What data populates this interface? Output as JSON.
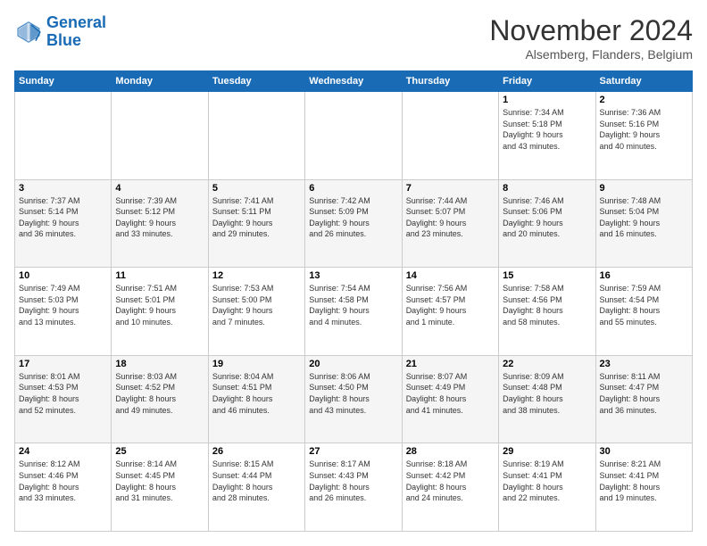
{
  "logo": {
    "line1": "General",
    "line2": "Blue"
  },
  "title": "November 2024",
  "location": "Alsemberg, Flanders, Belgium",
  "days_header": [
    "Sunday",
    "Monday",
    "Tuesday",
    "Wednesday",
    "Thursday",
    "Friday",
    "Saturday"
  ],
  "weeks": [
    [
      {
        "day": "",
        "info": ""
      },
      {
        "day": "",
        "info": ""
      },
      {
        "day": "",
        "info": ""
      },
      {
        "day": "",
        "info": ""
      },
      {
        "day": "",
        "info": ""
      },
      {
        "day": "1",
        "info": "Sunrise: 7:34 AM\nSunset: 5:18 PM\nDaylight: 9 hours\nand 43 minutes."
      },
      {
        "day": "2",
        "info": "Sunrise: 7:36 AM\nSunset: 5:16 PM\nDaylight: 9 hours\nand 40 minutes."
      }
    ],
    [
      {
        "day": "3",
        "info": "Sunrise: 7:37 AM\nSunset: 5:14 PM\nDaylight: 9 hours\nand 36 minutes."
      },
      {
        "day": "4",
        "info": "Sunrise: 7:39 AM\nSunset: 5:12 PM\nDaylight: 9 hours\nand 33 minutes."
      },
      {
        "day": "5",
        "info": "Sunrise: 7:41 AM\nSunset: 5:11 PM\nDaylight: 9 hours\nand 29 minutes."
      },
      {
        "day": "6",
        "info": "Sunrise: 7:42 AM\nSunset: 5:09 PM\nDaylight: 9 hours\nand 26 minutes."
      },
      {
        "day": "7",
        "info": "Sunrise: 7:44 AM\nSunset: 5:07 PM\nDaylight: 9 hours\nand 23 minutes."
      },
      {
        "day": "8",
        "info": "Sunrise: 7:46 AM\nSunset: 5:06 PM\nDaylight: 9 hours\nand 20 minutes."
      },
      {
        "day": "9",
        "info": "Sunrise: 7:48 AM\nSunset: 5:04 PM\nDaylight: 9 hours\nand 16 minutes."
      }
    ],
    [
      {
        "day": "10",
        "info": "Sunrise: 7:49 AM\nSunset: 5:03 PM\nDaylight: 9 hours\nand 13 minutes."
      },
      {
        "day": "11",
        "info": "Sunrise: 7:51 AM\nSunset: 5:01 PM\nDaylight: 9 hours\nand 10 minutes."
      },
      {
        "day": "12",
        "info": "Sunrise: 7:53 AM\nSunset: 5:00 PM\nDaylight: 9 hours\nand 7 minutes."
      },
      {
        "day": "13",
        "info": "Sunrise: 7:54 AM\nSunset: 4:58 PM\nDaylight: 9 hours\nand 4 minutes."
      },
      {
        "day": "14",
        "info": "Sunrise: 7:56 AM\nSunset: 4:57 PM\nDaylight: 9 hours\nand 1 minute."
      },
      {
        "day": "15",
        "info": "Sunrise: 7:58 AM\nSunset: 4:56 PM\nDaylight: 8 hours\nand 58 minutes."
      },
      {
        "day": "16",
        "info": "Sunrise: 7:59 AM\nSunset: 4:54 PM\nDaylight: 8 hours\nand 55 minutes."
      }
    ],
    [
      {
        "day": "17",
        "info": "Sunrise: 8:01 AM\nSunset: 4:53 PM\nDaylight: 8 hours\nand 52 minutes."
      },
      {
        "day": "18",
        "info": "Sunrise: 8:03 AM\nSunset: 4:52 PM\nDaylight: 8 hours\nand 49 minutes."
      },
      {
        "day": "19",
        "info": "Sunrise: 8:04 AM\nSunset: 4:51 PM\nDaylight: 8 hours\nand 46 minutes."
      },
      {
        "day": "20",
        "info": "Sunrise: 8:06 AM\nSunset: 4:50 PM\nDaylight: 8 hours\nand 43 minutes."
      },
      {
        "day": "21",
        "info": "Sunrise: 8:07 AM\nSunset: 4:49 PM\nDaylight: 8 hours\nand 41 minutes."
      },
      {
        "day": "22",
        "info": "Sunrise: 8:09 AM\nSunset: 4:48 PM\nDaylight: 8 hours\nand 38 minutes."
      },
      {
        "day": "23",
        "info": "Sunrise: 8:11 AM\nSunset: 4:47 PM\nDaylight: 8 hours\nand 36 minutes."
      }
    ],
    [
      {
        "day": "24",
        "info": "Sunrise: 8:12 AM\nSunset: 4:46 PM\nDaylight: 8 hours\nand 33 minutes."
      },
      {
        "day": "25",
        "info": "Sunrise: 8:14 AM\nSunset: 4:45 PM\nDaylight: 8 hours\nand 31 minutes."
      },
      {
        "day": "26",
        "info": "Sunrise: 8:15 AM\nSunset: 4:44 PM\nDaylight: 8 hours\nand 28 minutes."
      },
      {
        "day": "27",
        "info": "Sunrise: 8:17 AM\nSunset: 4:43 PM\nDaylight: 8 hours\nand 26 minutes."
      },
      {
        "day": "28",
        "info": "Sunrise: 8:18 AM\nSunset: 4:42 PM\nDaylight: 8 hours\nand 24 minutes."
      },
      {
        "day": "29",
        "info": "Sunrise: 8:19 AM\nSunset: 4:41 PM\nDaylight: 8 hours\nand 22 minutes."
      },
      {
        "day": "30",
        "info": "Sunrise: 8:21 AM\nSunset: 4:41 PM\nDaylight: 8 hours\nand 19 minutes."
      }
    ]
  ]
}
